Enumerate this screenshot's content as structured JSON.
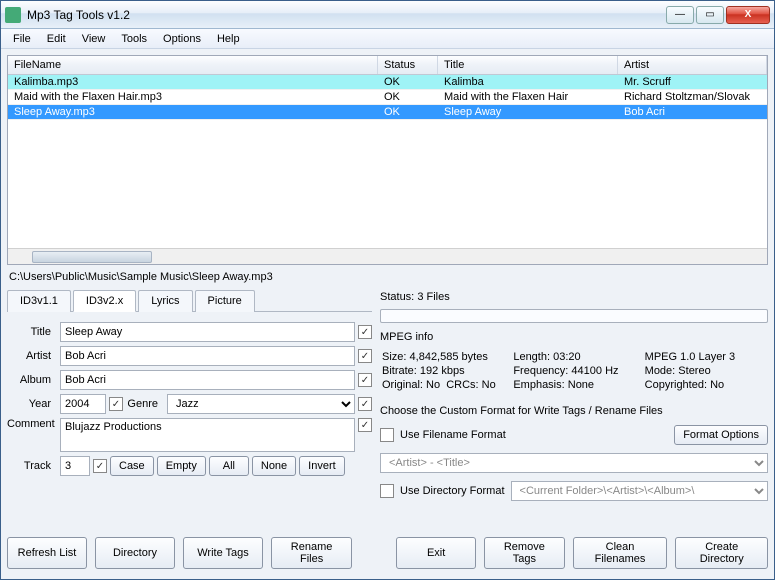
{
  "window": {
    "title": "Mp3 Tag Tools v1.2"
  },
  "menu": [
    "File",
    "Edit",
    "View",
    "Tools",
    "Options",
    "Help"
  ],
  "table": {
    "headers": [
      "FileName",
      "Status",
      "Title",
      "Artist"
    ],
    "rows": [
      {
        "fname": "Kalimba.mp3",
        "status": "OK",
        "title": "Kalimba",
        "artist": "Mr. Scruff",
        "hl": "hl0"
      },
      {
        "fname": "Maid with the Flaxen Hair.mp3",
        "status": "OK",
        "title": "Maid with the Flaxen Hair",
        "artist": "Richard Stoltzman/Slovak"
      },
      {
        "fname": "Sleep Away.mp3",
        "status": "OK",
        "title": "Sleep Away",
        "artist": "Bob Acri",
        "hl": "sel"
      }
    ]
  },
  "path": "C:\\Users\\Public\\Music\\Sample Music\\Sleep Away.mp3",
  "tabs": [
    "ID3v1.1",
    "ID3v2.x",
    "Lyrics",
    "Picture"
  ],
  "active_tab": 1,
  "form": {
    "labels": {
      "title": "Title",
      "artist": "Artist",
      "album": "Album",
      "year": "Year",
      "genre": "Genre",
      "comment": "Comment",
      "track": "Track"
    },
    "title": "Sleep Away",
    "artist": "Bob Acri",
    "album": "Bob Acri",
    "year": "2004",
    "genre": "Jazz",
    "comment": "Blujazz Productions",
    "track": "3",
    "case": "Case",
    "empty": "Empty",
    "all": "All",
    "none": "None",
    "invert": "Invert"
  },
  "status": {
    "label": "Status:",
    "text": "3 Files"
  },
  "mpeg": {
    "header": "MPEG info",
    "size_l": "Size:",
    "size_v": "4,842,585 bytes",
    "len_l": "Length:",
    "len_v": "03:20",
    "ver": "MPEG 1.0 Layer 3",
    "br_l": "Bitrate:",
    "br_v": "192 kbps",
    "fr_l": "Frequency:",
    "fr_v": "44100 Hz",
    "mode_l": "Mode:",
    "mode_v": "Stereo",
    "orig_l": "Original:",
    "orig_v": "No",
    "crc_l": "CRCs:",
    "crc_v": "No",
    "emph_l": "Emphasis:",
    "emph_v": "None",
    "copy_l": "Copyrighted:",
    "copy_v": "No"
  },
  "format": {
    "header": "Choose the Custom Format for Write Tags / Rename Files",
    "use_fname": "Use Filename Format",
    "fmt_opts": "Format Options",
    "fname_tmpl": "<Artist> - <Title>",
    "use_dir": "Use Directory Format",
    "dir_tmpl": "<Current Folder>\\<Artist>\\<Album>\\"
  },
  "buttons": {
    "refresh": "Refresh List",
    "dir": "Directory",
    "write": "Write Tags",
    "rename": "Rename Files",
    "exit": "Exit",
    "remove": "Remove Tags",
    "clean": "Clean Filenames",
    "create": "Create Directory"
  }
}
